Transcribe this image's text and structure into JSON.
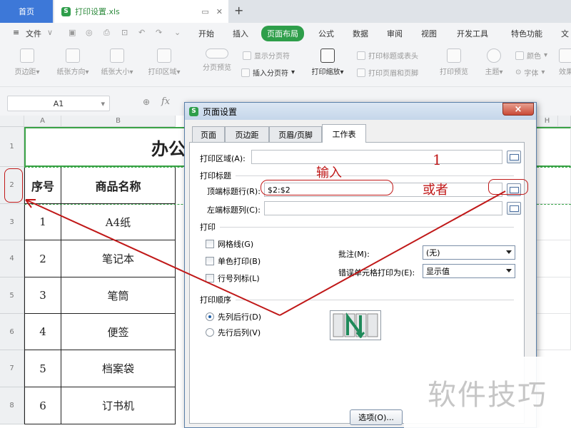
{
  "tabs": {
    "home": "首页",
    "document": "打印设置.xls",
    "add": "+"
  },
  "menu": {
    "file": "文件",
    "items": [
      "开始",
      "插入",
      "页面布局",
      "公式",
      "数据",
      "审阅",
      "视图",
      "开发工具",
      "特色功能",
      "文"
    ],
    "active": "页面布局"
  },
  "ribbon": {
    "margins": "页边距",
    "orientation": "纸张方向",
    "size": "纸张大小",
    "print_area": "打印区域",
    "preview_breaks": "分页预览",
    "show_breaks": "显示分页符",
    "insert_break": "插入分页符",
    "print_scale": "打印缩放",
    "print_titles": "打印标题或表头",
    "print_header_footer": "打印页眉和页脚",
    "print_preview": "打印预览",
    "theme": "主题",
    "colors": "颜色",
    "fonts": "字体",
    "effects": "效果"
  },
  "formula_bar": {
    "cell_ref": "A1",
    "fx": "fx"
  },
  "sheet": {
    "columns": [
      "A",
      "B",
      "H"
    ],
    "rows": [
      "1",
      "2",
      "3",
      "4",
      "5",
      "6",
      "7",
      "8"
    ],
    "title_fragment": "办公",
    "header": {
      "index": "序号",
      "name": "商品名称"
    },
    "items": [
      {
        "index": "1",
        "name": "A4纸"
      },
      {
        "index": "2",
        "name": "笔记本"
      },
      {
        "index": "3",
        "name": "笔筒"
      },
      {
        "index": "4",
        "name": "便签"
      },
      {
        "index": "5",
        "name": "档案袋"
      },
      {
        "index": "6",
        "name": "订书机"
      }
    ]
  },
  "dialog": {
    "title": "页面设置",
    "tabs": [
      "页面",
      "页边距",
      "页眉/页脚",
      "工作表"
    ],
    "active_tab": "工作表",
    "print_area_label": "打印区域(A):",
    "print_titles_section": "打印标题",
    "title_rows_label": "顶端标题行(R):",
    "title_rows_value": "$2:$2",
    "title_cols_label": "左端标题列(C):",
    "print_section": "打印",
    "gridlines": "网格线(G)",
    "mono": "单色打印(B)",
    "row_col_headers": "行号列标(L)",
    "comments_label": "批注(M):",
    "comments_value": "(无)",
    "errors_label": "错误单元格打印为(E):",
    "errors_value": "显示值",
    "order_section": "打印顺序",
    "order_down_then_over": "先列后行(D)",
    "order_over_then_down": "先行后列(V)",
    "options_button": "选项(O)...",
    "close": "×"
  },
  "annotations": {
    "input": "输入",
    "number": "1",
    "or": "或者"
  },
  "watermark": "软件技巧",
  "colors": {
    "wps_green": "#2e9e4a",
    "home_tab": "#3d78d8",
    "annotation_red": "#c01818"
  }
}
